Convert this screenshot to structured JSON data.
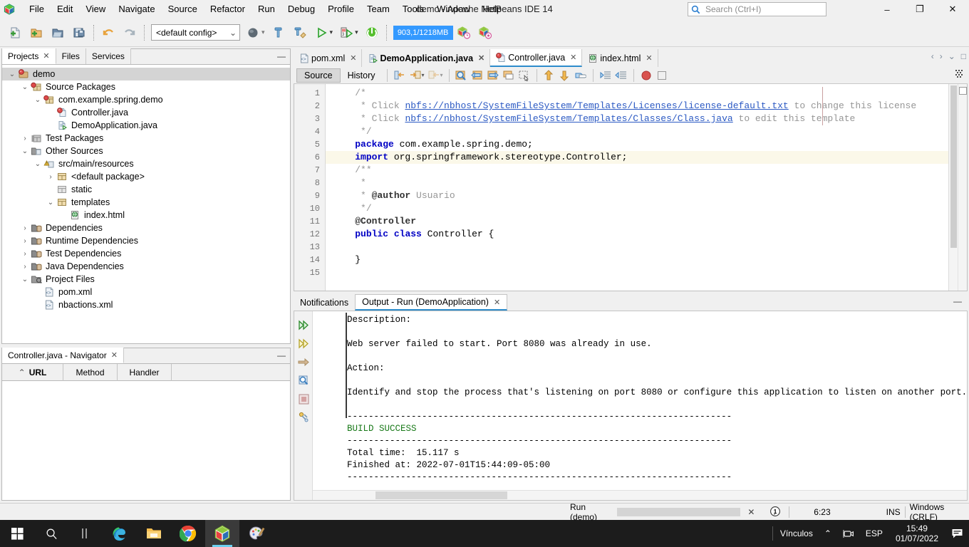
{
  "window": {
    "title": "demo - Apache NetBeans IDE 14",
    "minimize": "–",
    "maximize": "❐",
    "close": "✕"
  },
  "menubar": {
    "items": [
      {
        "label": "File"
      },
      {
        "label": "Edit"
      },
      {
        "label": "View"
      },
      {
        "label": "Navigate"
      },
      {
        "label": "Source"
      },
      {
        "label": "Refactor"
      },
      {
        "label": "Run"
      },
      {
        "label": "Debug"
      },
      {
        "label": "Profile"
      },
      {
        "label": "Team"
      },
      {
        "label": "Tools"
      },
      {
        "label": "Window"
      },
      {
        "label": "Help"
      }
    ]
  },
  "search": {
    "placeholder": "Search (Ctrl+I)",
    "icon": "search-icon"
  },
  "toolbar": {
    "config_combo": "<default config>",
    "config_caret": "⌄",
    "memory": "903,1/1218MB",
    "icons": [
      "new-file-icon",
      "new-project-icon",
      "open-project-icon",
      "save-all-icon",
      "undo-icon",
      "redo-icon",
      "build-globe-icon",
      "build-project-icon",
      "clean-build-icon",
      "run-project-icon",
      "debug-project-icon",
      "stop-icon",
      "profile-icon",
      "team-history-icon"
    ]
  },
  "left_panel": {
    "tabs": [
      {
        "label": "Projects",
        "active": true,
        "closable": true
      },
      {
        "label": "Files",
        "active": false,
        "closable": false
      },
      {
        "label": "Services",
        "active": false,
        "closable": false
      }
    ],
    "minimize_glyph": "—",
    "tree": [
      {
        "label": "demo",
        "depth": 0,
        "twisty": "⌄",
        "icon": "project-icon",
        "selected": true
      },
      {
        "label": "Source Packages",
        "depth": 1,
        "twisty": "⌄",
        "icon": "source-packages-icon",
        "selected": false
      },
      {
        "label": "com.example.spring.demo",
        "depth": 2,
        "twisty": "⌄",
        "icon": "package-icon",
        "selected": false
      },
      {
        "label": "Controller.java",
        "depth": 3,
        "twisty": "",
        "icon": "java-class-icon",
        "selected": false
      },
      {
        "label": "DemoApplication.java",
        "depth": 3,
        "twisty": "",
        "icon": "java-main-class-icon",
        "selected": false
      },
      {
        "label": "Test Packages",
        "depth": 1,
        "twisty": "›",
        "icon": "test-packages-icon",
        "selected": false
      },
      {
        "label": "Other Sources",
        "depth": 1,
        "twisty": "⌄",
        "icon": "other-sources-icon",
        "selected": false
      },
      {
        "label": "src/main/resources",
        "depth": 2,
        "twisty": "⌄",
        "icon": "resources-folder-icon",
        "selected": false
      },
      {
        "label": "<default package>",
        "depth": 3,
        "twisty": "›",
        "icon": "package-folder-icon",
        "selected": false
      },
      {
        "label": "static",
        "depth": 3,
        "twisty": "",
        "icon": "package-folder-gray-icon",
        "selected": false
      },
      {
        "label": "templates",
        "depth": 3,
        "twisty": "⌄",
        "icon": "package-folder-icon",
        "selected": false
      },
      {
        "label": "index.html",
        "depth": 4,
        "twisty": "",
        "icon": "html-file-icon",
        "selected": false
      },
      {
        "label": "Dependencies",
        "depth": 1,
        "twisty": "›",
        "icon": "dependencies-icon",
        "selected": false
      },
      {
        "label": "Runtime Dependencies",
        "depth": 1,
        "twisty": "›",
        "icon": "dependencies-icon",
        "selected": false
      },
      {
        "label": "Test Dependencies",
        "depth": 1,
        "twisty": "›",
        "icon": "dependencies-icon",
        "selected": false
      },
      {
        "label": "Java Dependencies",
        "depth": 1,
        "twisty": "›",
        "icon": "dependencies-icon",
        "selected": false
      },
      {
        "label": "Project Files",
        "depth": 1,
        "twisty": "⌄",
        "icon": "project-files-icon",
        "selected": false
      },
      {
        "label": "pom.xml",
        "depth": 2,
        "twisty": "",
        "icon": "xml-file-icon",
        "selected": false
      },
      {
        "label": "nbactions.xml",
        "depth": 2,
        "twisty": "",
        "icon": "xml-file-icon",
        "selected": false
      }
    ]
  },
  "navigator": {
    "tab_label": "Controller.java - Navigator",
    "close_glyph": "✕",
    "minimize_glyph": "—",
    "sort_glyph": "⌃",
    "columns": [
      "URL",
      "Method",
      "Handler",
      ""
    ]
  },
  "editor": {
    "tabs": [
      {
        "label": "pom.xml",
        "icon": "xml-file-icon",
        "active": false,
        "bold": false
      },
      {
        "label": "DemoApplication.java",
        "icon": "java-main-class-icon",
        "active": false,
        "bold": true
      },
      {
        "label": "Controller.java",
        "icon": "java-class-icon",
        "active": true,
        "bold": false
      },
      {
        "label": "index.html",
        "icon": "html-file-icon",
        "active": false,
        "bold": false
      }
    ],
    "tab_close": "✕",
    "nav_prev": "‹",
    "nav_next": "›",
    "nav_list": "⌄",
    "nav_max": "□",
    "toolbar": {
      "source_label": "Source",
      "history_label": "History",
      "icons": [
        "last-edit-icon",
        "back-icon",
        "forward-icon",
        "find-selection-icon",
        "previous-bookmark-icon",
        "next-bookmark-icon",
        "toggle-bookmark-icon",
        "toggle-rect-selection-icon",
        "previous-error-icon",
        "next-error-icon",
        "toggle-highlight-icon",
        "shift-left-icon",
        "shift-right-icon",
        "start-macro-recording-icon",
        "stop-macro-recording-icon"
      ]
    },
    "lines": [
      {
        "n": 1,
        "highlight": false,
        "segments": [
          {
            "t": "/*",
            "c": "cm"
          }
        ],
        "indent": "    "
      },
      {
        "n": 2,
        "highlight": false,
        "indent": "     ",
        "segments": [
          {
            "t": "* Click ",
            "c": "cm"
          },
          {
            "t": "nbfs://nbhost/SystemFileSystem/Templates/Licenses/license-default.txt",
            "c": "lnk"
          },
          {
            "t": " to change this license",
            "c": "cm"
          }
        ]
      },
      {
        "n": 3,
        "highlight": false,
        "indent": "     ",
        "segments": [
          {
            "t": "* Click ",
            "c": "cm"
          },
          {
            "t": "nbfs://nbhost/SystemFileSystem/Templates/Classes/Class.java",
            "c": "lnk"
          },
          {
            "t": " to edit this template",
            "c": "cm"
          }
        ]
      },
      {
        "n": 4,
        "highlight": false,
        "indent": "     ",
        "segments": [
          {
            "t": "*/",
            "c": "cm"
          }
        ]
      },
      {
        "n": 5,
        "highlight": false,
        "indent": "    ",
        "segments": [
          {
            "t": "package",
            "c": "kw"
          },
          {
            "t": " com.example.spring.demo;",
            "c": "cls"
          }
        ]
      },
      {
        "n": 6,
        "highlight": true,
        "indent": "    ",
        "segments": [
          {
            "t": "import",
            "c": "kw"
          },
          {
            "t": " org.springframework.stereotype.Controller;",
            "c": "cls"
          }
        ]
      },
      {
        "n": 7,
        "highlight": false,
        "indent": "    ",
        "segments": [
          {
            "t": "/**",
            "c": "cm"
          }
        ]
      },
      {
        "n": 8,
        "highlight": false,
        "indent": "     ",
        "segments": [
          {
            "t": "*",
            "c": "cm"
          }
        ]
      },
      {
        "n": 9,
        "highlight": false,
        "indent": "     ",
        "segments": [
          {
            "t": "* ",
            "c": "cm"
          },
          {
            "t": "@author",
            "c": "ann"
          },
          {
            "t": " Usuario",
            "c": "cm"
          }
        ]
      },
      {
        "n": 10,
        "highlight": false,
        "indent": "     ",
        "segments": [
          {
            "t": "*/",
            "c": "cm"
          }
        ]
      },
      {
        "n": 11,
        "highlight": false,
        "indent": "    ",
        "segments": [
          {
            "t": "@Controller",
            "c": "ann"
          }
        ]
      },
      {
        "n": 12,
        "highlight": false,
        "indent": "    ",
        "segments": [
          {
            "t": "public",
            "c": "kw"
          },
          {
            "t": " ",
            "c": "cls"
          },
          {
            "t": "class",
            "c": "kw"
          },
          {
            "t": " Controller {",
            "c": "cls"
          }
        ]
      },
      {
        "n": 13,
        "highlight": false,
        "indent": "    ",
        "segments": []
      },
      {
        "n": 14,
        "highlight": false,
        "indent": "    ",
        "segments": [
          {
            "t": "}",
            "c": "cls"
          }
        ]
      },
      {
        "n": 15,
        "highlight": false,
        "indent": "    ",
        "segments": []
      }
    ]
  },
  "output": {
    "tabs": [
      {
        "label": "Notifications",
        "active": false,
        "closable": false
      },
      {
        "label": "Output - Run (DemoApplication)",
        "active": true,
        "closable": true
      }
    ],
    "close_glyph": "✕",
    "minimize_glyph": "—",
    "strip_icons": [
      "rerun-icon",
      "rerun-with-different-params-icon",
      "forward-icon",
      "find-icon",
      "stop-icon",
      "settings-icon"
    ],
    "console": [
      {
        "text": "Description:",
        "color": "black"
      },
      {
        "text": "",
        "color": "black"
      },
      {
        "text": "Web server failed to start. Port 8080 was already in use.",
        "color": "black"
      },
      {
        "text": "",
        "color": "black"
      },
      {
        "text": "Action:",
        "color": "black"
      },
      {
        "text": "",
        "color": "black"
      },
      {
        "text": "Identify and stop the process that's listening on port 8080 or configure this application to listen on another port.",
        "color": "black"
      },
      {
        "text": "",
        "color": "black"
      },
      {
        "text": "------------------------------------------------------------------------",
        "color": "black"
      },
      {
        "text": "BUILD SUCCESS",
        "color": "green"
      },
      {
        "text": "------------------------------------------------------------------------",
        "color": "black"
      },
      {
        "text": "Total time:  15.117 s",
        "color": "black"
      },
      {
        "text": "Finished at: 2022-07-01T15:44:09-05:00",
        "color": "black"
      },
      {
        "text": "------------------------------------------------------------------------",
        "color": "black"
      }
    ]
  },
  "statusbar": {
    "run_label": "Run (demo)",
    "cancel_glyph": "✕",
    "notification_count": "1",
    "caret_position": "6:23",
    "insert_mode": "INS",
    "line_ending": "Windows (CRLF)"
  },
  "taskbar": {
    "items": [
      {
        "name": "start-button",
        "icon": "windows-logo-icon",
        "active": false,
        "running": false
      },
      {
        "name": "search-button",
        "icon": "search-icon",
        "active": false,
        "running": false
      },
      {
        "name": "task-view-button",
        "icon": "task-view-icon",
        "active": false,
        "running": false
      },
      {
        "name": "edge-button",
        "icon": "edge-icon",
        "active": false,
        "running": true
      },
      {
        "name": "explorer-button",
        "icon": "file-explorer-icon",
        "active": false,
        "running": true
      },
      {
        "name": "chrome-button",
        "icon": "chrome-icon",
        "active": false,
        "running": true
      },
      {
        "name": "netbeans-button",
        "icon": "netbeans-icon",
        "active": true,
        "running": true
      },
      {
        "name": "paint-button",
        "icon": "paint-icon",
        "active": false,
        "running": true
      }
    ],
    "tray": {
      "label": "Vínculos",
      "chevron": "⌃",
      "camera_icon": "camera-icon",
      "language": "ESP",
      "time": "15:49",
      "date": "01/07/2022",
      "action_center_icon": "action-center-icon"
    }
  },
  "colors": {
    "accent": "#2d8ccc",
    "memory_bar": "#3399ff",
    "build_success": "#1a7a1a",
    "link": "#2b59c3",
    "keyword": "#0000c4",
    "comment": "#969696"
  }
}
